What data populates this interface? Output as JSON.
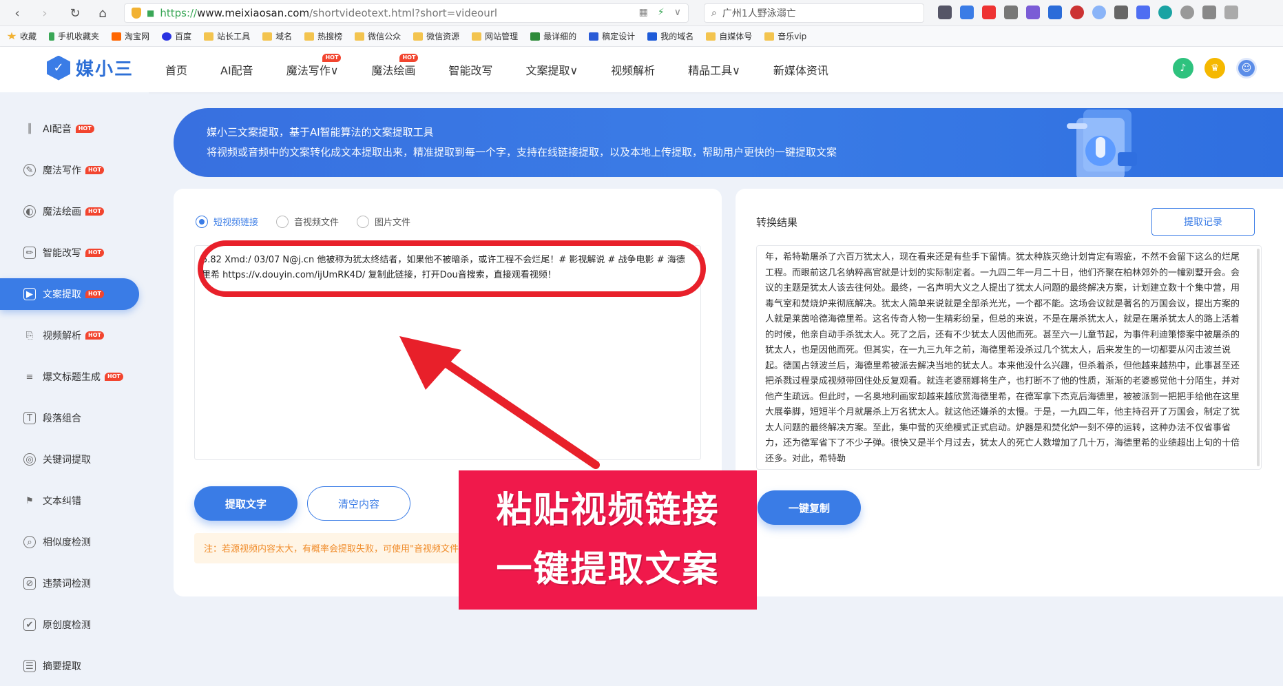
{
  "browser": {
    "url_proto": "https://",
    "url_host": "www.meixiaosan.com",
    "url_path": "/shortvideotext.html?short=videourl",
    "search_text": "广州1人野泳溺亡",
    "bookmarks": [
      "收藏",
      "手机收藏夹",
      "淘宝网",
      "百度",
      "站长工具",
      "域名",
      "热搜榜",
      "微信公众",
      "微信资源",
      "网站管理",
      "最详细的",
      "稿定设计",
      "我的域名",
      "自媒体号",
      "音乐vip"
    ]
  },
  "header": {
    "logo_text": "媒小三",
    "nav": [
      {
        "label": "首页"
      },
      {
        "label": "AI配音"
      },
      {
        "label": "魔法写作∨",
        "hot": "HOT"
      },
      {
        "label": "魔法绘画",
        "hot": "HOT"
      },
      {
        "label": "智能改写"
      },
      {
        "label": "文案提取∨"
      },
      {
        "label": "视频解析"
      },
      {
        "label": "精品工具∨"
      },
      {
        "label": "新媒体资讯"
      }
    ]
  },
  "sidebar": {
    "items": [
      {
        "label": "AI配音",
        "icon": "audio-wave-icon",
        "hot": "HOT"
      },
      {
        "label": "魔法写作",
        "icon": "magic-write-icon",
        "hot": "HOT"
      },
      {
        "label": "魔法绘画",
        "icon": "palette-icon",
        "hot": "HOT"
      },
      {
        "label": "智能改写",
        "icon": "edit-icon",
        "hot": "HOT"
      },
      {
        "label": "文案提取",
        "icon": "play-doc-icon",
        "hot": "HOT",
        "active": true
      },
      {
        "label": "视频解析",
        "icon": "video-parse-icon",
        "hot": "HOT"
      },
      {
        "label": "爆文标题生成",
        "icon": "title-icon",
        "hot": "HOT"
      },
      {
        "label": "段落组合",
        "icon": "paragraph-icon"
      },
      {
        "label": "关键词提取",
        "icon": "keyword-icon"
      },
      {
        "label": "文本纠错",
        "icon": "spellcheck-icon"
      },
      {
        "label": "相似度检测",
        "icon": "similarity-icon"
      },
      {
        "label": "违禁词检测",
        "icon": "forbidden-icon"
      },
      {
        "label": "原创度检测",
        "icon": "original-icon"
      },
      {
        "label": "摘要提取",
        "icon": "summary-icon"
      }
    ]
  },
  "banner": {
    "line1": "媒小三文案提取，基于AI智能算法的文案提取工具",
    "line2": "将视频或音频中的文案转化成文本提取出来，精准提取到每一个字，支持在线链接提取，以及本地上传提取，帮助用户更快的一键提取文案"
  },
  "input_panel": {
    "radio_options": [
      "短视频链接",
      "音视频文件",
      "图片文件"
    ],
    "selected": "短视频链接",
    "textarea_value": "5.82 Xmd:/ 03/07 N@j.cn 他被称为犹太终结者，如果他不被暗杀，或许工程不会烂尾！# 影视解说 # 战争电影 # 海德里希  https://v.douyin.com/ijUmRK4D/ 复制此链接，打开Dou音搜索，直接观看视频！",
    "extract_button": "提取文字",
    "clear_button": "清空内容",
    "notice": "注：若源视频内容太大，有概率会提取失败，可使用\"音视频文件\"上传提取"
  },
  "result_panel": {
    "title": "转换结果",
    "record_button": "提取记录",
    "result_text": "年，希特勒屠杀了六百万犹太人，现在看来还是有些手下留情。犹太种族灭绝计划肯定有瑕疵，不然不会留下这么的烂尾工程。而眼前这几名纳粹高官就是计划的实际制定者。一九四二年一月二十日，他们齐聚在柏林郊外的一幢别墅开会。会议的主题是犹太人该去往何处。最终，一名声明大义之人提出了犹太人问题的最终解决方案，计划建立数十个集中营，用毒气室和焚烧炉来彻底解决。犹太人简单来说就是全部杀光光，一个都不能。这场会议就是著名的万国会议，提出方案的人就是莱茵哈德海德里希。这名传奇人物一生精彩纷呈，但总的来说，不是在屠杀犹太人，就是在屠杀犹太人的路上活着的时候，他亲自动手杀犹太人。死了之后，还有不少犹太人因他而死。甚至六一儿童节起，为事件利迪策惨案中被屠杀的犹太人，也是因他而死。但其实，在一九三九年之前，海德里希没杀过几个犹太人，后来发生的一切都要从闪击波兰说起。德国占领波兰后，海德里希被派去解决当地的犹太人。本来他没什么兴趣，但杀着杀，但他越来越热中，此事甚至还把杀戮过程录成视频带回住处反复观看。就连老婆丽娜将生产，也打断不了他的性质，渐渐的老婆感觉他十分陌生，并对他产生疏远。但此时，一名奥地利画家却越来越欣赏海德里希，在德军拿下杰克后海德里，被被派到一把把手给他在这里大展拳脚，短短半个月就屠杀上万名犹太人。就这他还嫌杀的太慢。于是，一九四二年，他主持召开了万国会，制定了犹太人问题的最终解决方案。至此，集中营的灭绝模式正式启动。炉器是和焚化炉一刻不停的运转，这种办法不仅省事省力，还为德军省下了不少子弹。很快又是半个月过去，犹太人的死亡人数增加了几十万，海德里希的业绩超出上旬的十倍还多。对此，希特勒",
    "copy_button": "一键复制"
  },
  "overlay": {
    "caption_line1": "粘贴视频链接",
    "caption_line2": "一键提取文案"
  },
  "colors": {
    "accent": "#3a7ce6",
    "hot": "#f2452f",
    "caption_bg": "#f0194b",
    "annotation_red": "#e8202a"
  }
}
